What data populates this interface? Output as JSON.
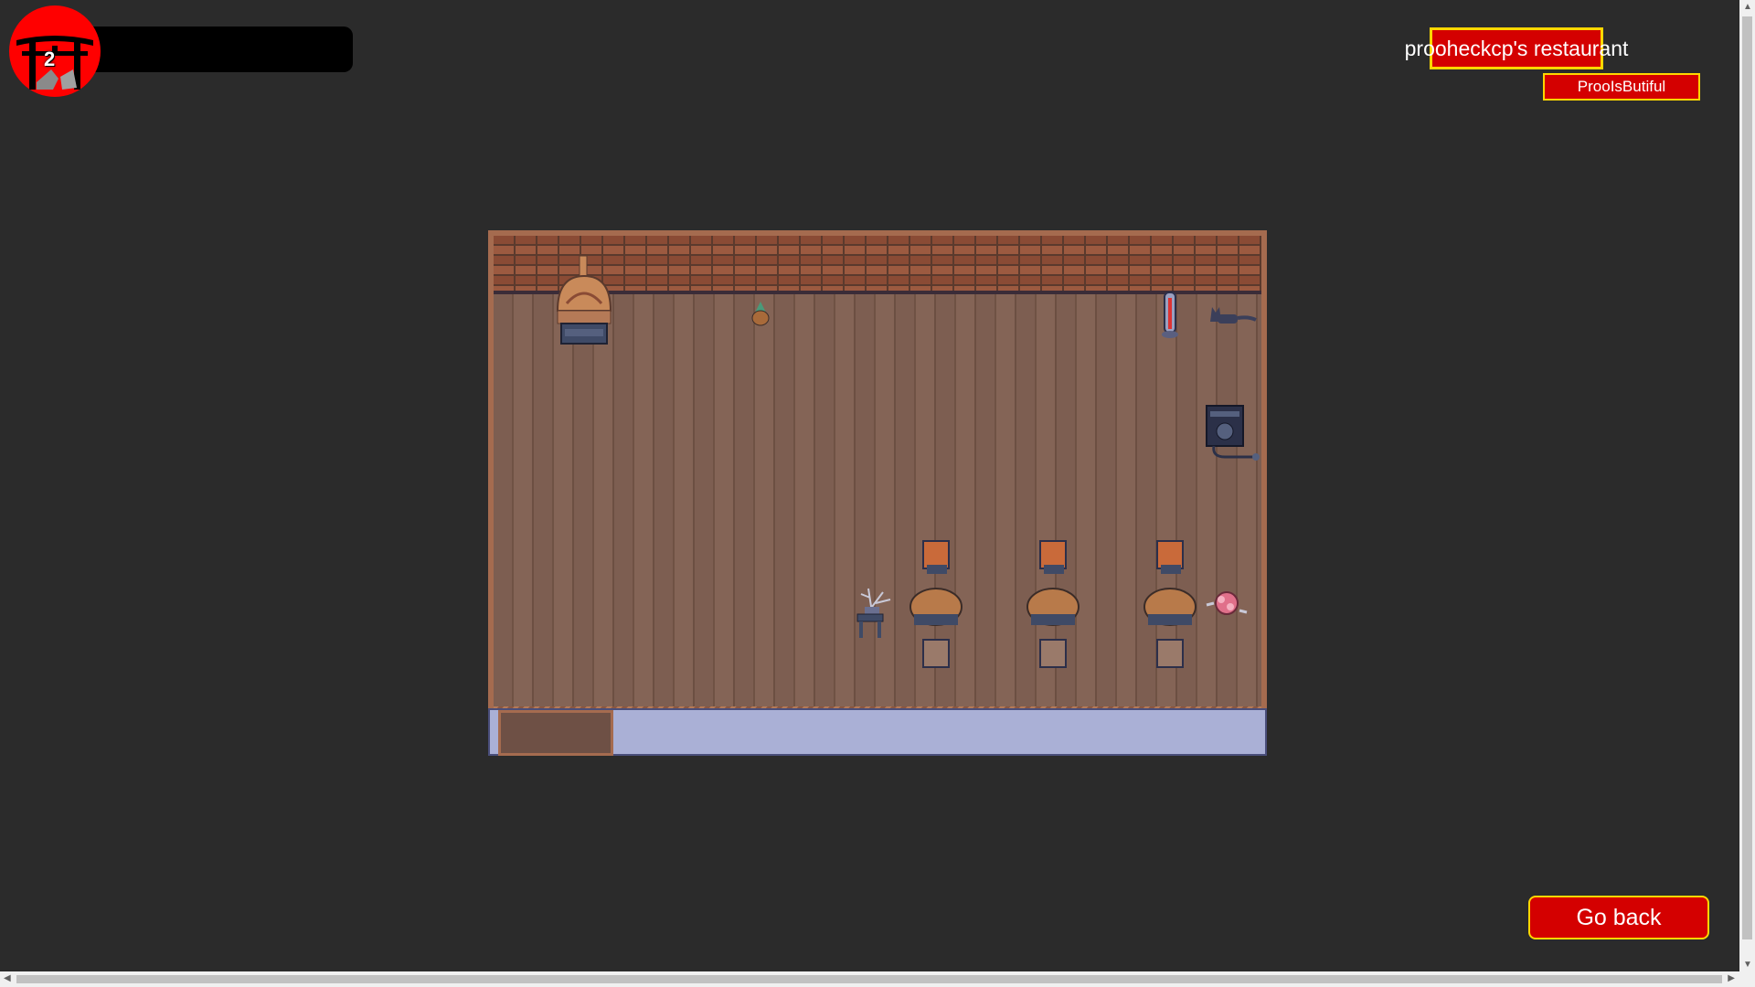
{
  "hud": {
    "level": "2",
    "xp_progress": 0
  },
  "restaurant": {
    "title": "prooheckcp's restaurant",
    "owner": "ProoIsButiful"
  },
  "room": {
    "furniture": [
      "brick-oven",
      "potted-plant",
      "thermometer",
      "cat",
      "speaker",
      "side-table-plant",
      "table-1",
      "table-2",
      "table-3",
      "flower-bouquet"
    ]
  },
  "buttons": {
    "go_back": "Go back"
  },
  "colors": {
    "accent": "#d40000",
    "border": "#ffd700",
    "background": "#2b2b2b"
  }
}
